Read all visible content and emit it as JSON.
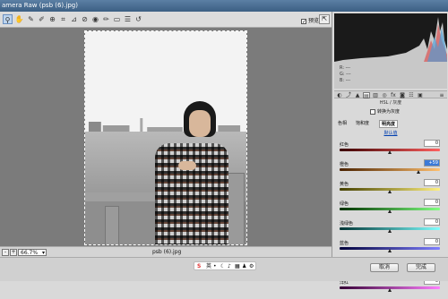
{
  "window": {
    "title": "amera Raw (psb (6).jpg)"
  },
  "toolbar": {
    "tools": [
      "zoom-icon",
      "hand-icon",
      "eyedropper-icon",
      "color-sampler-icon",
      "target-adjust-icon",
      "crop-icon",
      "straighten-icon",
      "spot-removal-icon",
      "redeye-icon",
      "brush-icon",
      "grad-filter-icon",
      "prefs-icon",
      "rotate-ccw-icon"
    ],
    "preview_label": "预览",
    "preview_checked": "✓",
    "fullscreen_label": "⇱"
  },
  "statusbar": {
    "zoom_minus": "-",
    "zoom_plus": "+",
    "zoom": "66.7%",
    "filename": "psb (6).jpg"
  },
  "histogram": {
    "readout": {
      "r_label": "R:",
      "r_value": "---",
      "g_label": "G:",
      "g_value": "---",
      "b_label": "B:",
      "b_value": "---"
    }
  },
  "panel": {
    "title": "HSL / 灰度",
    "grayscale_label": "转换为灰度",
    "subtabs": [
      "色相",
      "饱和度",
      "明亮度"
    ],
    "active_subtab": "明亮度",
    "defaults_link": "默认值",
    "rows": [
      {
        "label": "红色",
        "value": "0",
        "level": 0.5,
        "track": "linear-gradient(90deg,#3a0000,#ff6060)"
      },
      {
        "label": "橙色",
        "value": "+59",
        "level": 0.79,
        "track": "linear-gradient(90deg,#4a2200,#ffc070)",
        "selected": true
      },
      {
        "label": "黄色",
        "value": "0",
        "level": 0.5,
        "track": "linear-gradient(90deg,#444000,#fff080)"
      },
      {
        "label": "绿色",
        "value": "0",
        "level": 0.5,
        "track": "linear-gradient(90deg,#003000,#80ff80)"
      },
      {
        "label": "浅绿色",
        "value": "0",
        "level": 0.5,
        "track": "linear-gradient(90deg,#003535,#80ffff)"
      },
      {
        "label": "蓝色",
        "value": "0",
        "level": 0.5,
        "track": "linear-gradient(90deg,#00003a,#8080ff)"
      },
      {
        "label": "紫色",
        "value": "0",
        "level": 0.5,
        "track": "linear-gradient(90deg,#220035,#d080ff)"
      },
      {
        "label": "洋红",
        "value": "0",
        "level": 0.5,
        "track": "linear-gradient(90deg,#350035,#ff80ff)"
      }
    ]
  },
  "bottom": {
    "cancel_label": "取消",
    "done_label": "完成"
  },
  "ime": {
    "logo": "S",
    "items": [
      "英",
      "•",
      "☾",
      "♪",
      "▦",
      "♟",
      "⚙"
    ]
  },
  "colors": {
    "accent": "#3b7ad8",
    "link": "#003fb0"
  }
}
